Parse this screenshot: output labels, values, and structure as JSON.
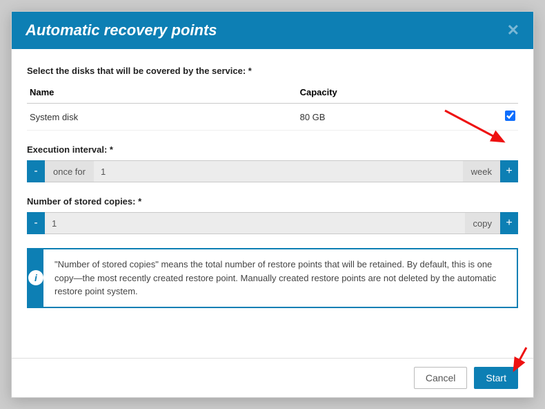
{
  "modal": {
    "title": "Automatic recovery points",
    "disks_label": "Select the disks that will be covered by the service: *",
    "table": {
      "headers": {
        "name": "Name",
        "capacity": "Capacity"
      },
      "rows": [
        {
          "name": "System disk",
          "capacity": "80 GB",
          "checked": true
        }
      ]
    },
    "interval": {
      "label": "Execution interval: *",
      "prefix": "once for",
      "value": "1",
      "unit": "week"
    },
    "copies": {
      "label": "Number of stored copies: *",
      "value": "1",
      "unit": "copy"
    },
    "info": "\"Number of stored copies\" means the total number of restore points that will be retained. By default, this is one copy—the most recently created restore point. Manually created restore points are not deleted by the automatic restore point system.",
    "buttons": {
      "cancel": "Cancel",
      "start": "Start"
    },
    "icons": {
      "info": "i",
      "close": "✕",
      "minus": "-",
      "plus": "+"
    }
  }
}
